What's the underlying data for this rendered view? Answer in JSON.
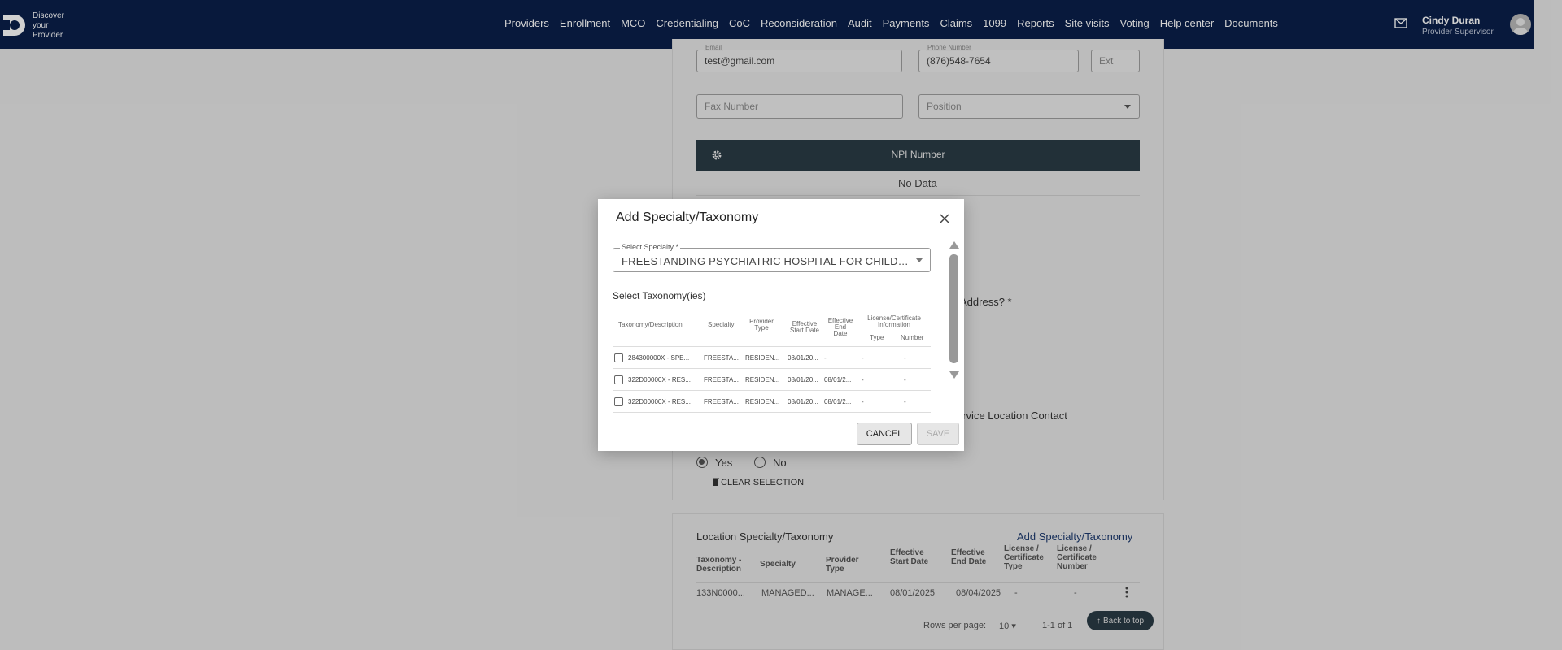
{
  "header": {
    "logo_lines": [
      "Discover",
      "your",
      "Provider"
    ],
    "nav": [
      "Providers",
      "Enrollment",
      "MCO",
      "Credentialing",
      "CoC",
      "Reconsideration",
      "Audit",
      "Payments",
      "Claims",
      "1099",
      "Reports",
      "Site visits",
      "Voting",
      "Help center",
      "Documents"
    ],
    "user_name": "Cindy Duran",
    "user_role": "Provider Supervisor"
  },
  "background": {
    "email_label": "Email",
    "email_value": "test@gmail.com",
    "phone_label": "Phone Number",
    "phone_value": "(876)548-7654",
    "ext_placeholder": "Ext",
    "fax_placeholder": "Fax Number",
    "position_placeholder": "Position",
    "npi_header": "NPI Number",
    "no_data": "No Data",
    "address_fragment": "Address? *",
    "contact_fragment": "ervice Location Contact",
    "radio_yes": "Yes",
    "radio_no": "No",
    "clear_selection": "CLEAR SELECTION",
    "location_title": "Location Specialty/Taxonomy",
    "add_specialty_link": "Add Specialty/Taxonomy",
    "location_headers": [
      "Taxonomy - Description",
      "Specialty",
      "Provider Type",
      "Effective Start Date",
      "Effective End Date",
      "License / Certificate Type",
      "License / Certificate Number"
    ],
    "location_row": [
      "133N0000...",
      "MANAGED...",
      "MANAGE...",
      "08/01/2025",
      "08/04/2025",
      "-",
      "-"
    ],
    "rows_per_page_label": "Rows per page:",
    "rows_per_page_value": "10",
    "pagination": "1-1 of 1",
    "back_to_top": "Back to top"
  },
  "modal": {
    "title": "Add Specialty/Taxonomy",
    "select_label": "Select Specialty *",
    "select_value": "FREESTANDING PSYCHIATRIC HOSPITAL FOR CHILDREN ...",
    "taxonomy_title": "Select Taxonomy(ies)",
    "headers": {
      "taxonomy": "Taxonomy/Description",
      "specialty": "Specialty",
      "provider_type": "Provider Type",
      "start": "Effective Start Date",
      "end": "Effective End Date",
      "license_group": "License/Certificate Information",
      "type": "Type",
      "number": "Number"
    },
    "rows": [
      [
        "284300000X - SPE...",
        "FREESTA...",
        "RESIDEN...",
        "08/01/20...",
        "-",
        "-",
        "-"
      ],
      [
        "322D00000X - RES...",
        "FREESTA...",
        "RESIDEN...",
        "08/01/20...",
        "08/01/2...",
        "-",
        "-"
      ],
      [
        "322D00000X - RES...",
        "FREESTA...",
        "RESIDEN...",
        "08/01/20...",
        "08/01/2...",
        "-",
        "-"
      ]
    ],
    "cancel_label": "CANCEL",
    "save_label": "SAVE"
  }
}
